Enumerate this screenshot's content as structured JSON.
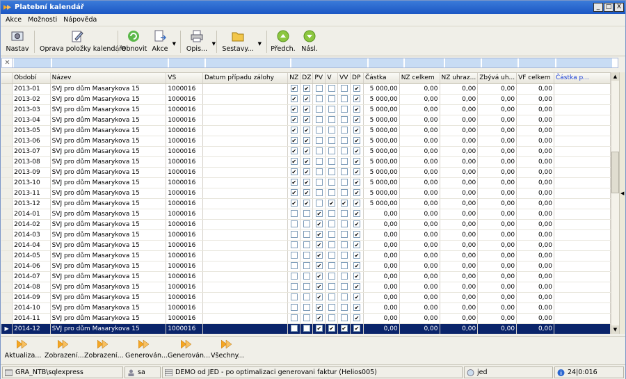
{
  "window": {
    "title": "Platební kalendář",
    "min": "_",
    "max": "□",
    "close": "X"
  },
  "menu": [
    "Akce",
    "Možnosti",
    "Nápověda"
  ],
  "toolbar": {
    "nastav": "Nastav",
    "oprava": "Oprava položky kalendáře",
    "obnovit": "Obnovit",
    "akce": "Akce",
    "opis": "Opis...",
    "sestavy": "Sestavy...",
    "predch": "Předch.",
    "nasl": "Násl."
  },
  "columns": [
    "Období",
    "Název",
    "VS",
    "Datum případu zálohy",
    "NZ",
    "DZ",
    "PV",
    "V",
    "VV",
    "DP",
    "Částka",
    "NZ celkem",
    "NZ uhraz...",
    "Zbývá uh...",
    "VF celkem",
    "Částka p..."
  ],
  "rows": [
    {
      "obdobi": "2013-01",
      "nazev": "SVJ pro dům Masarykova 15",
      "vs": "1000016",
      "datum": "",
      "nz": true,
      "dz": true,
      "pv": false,
      "v": false,
      "vv": false,
      "dp": true,
      "castka": "5 000,00",
      "nzc": "0,00",
      "nzu": "0,00",
      "zbyva": "0,00",
      "vfc": "0,00",
      "castkap": ""
    },
    {
      "obdobi": "2013-02",
      "nazev": "SVJ pro dům Masarykova 15",
      "vs": "1000016",
      "datum": "",
      "nz": true,
      "dz": true,
      "pv": false,
      "v": false,
      "vv": false,
      "dp": true,
      "castka": "5 000,00",
      "nzc": "0,00",
      "nzu": "0,00",
      "zbyva": "0,00",
      "vfc": "0,00",
      "castkap": ""
    },
    {
      "obdobi": "2013-03",
      "nazev": "SVJ pro dům Masarykova 15",
      "vs": "1000016",
      "datum": "",
      "nz": true,
      "dz": true,
      "pv": false,
      "v": false,
      "vv": false,
      "dp": true,
      "castka": "5 000,00",
      "nzc": "0,00",
      "nzu": "0,00",
      "zbyva": "0,00",
      "vfc": "0,00",
      "castkap": ""
    },
    {
      "obdobi": "2013-04",
      "nazev": "SVJ pro dům Masarykova 15",
      "vs": "1000016",
      "datum": "",
      "nz": true,
      "dz": true,
      "pv": false,
      "v": false,
      "vv": false,
      "dp": true,
      "castka": "5 000,00",
      "nzc": "0,00",
      "nzu": "0,00",
      "zbyva": "0,00",
      "vfc": "0,00",
      "castkap": ""
    },
    {
      "obdobi": "2013-05",
      "nazev": "SVJ pro dům Masarykova 15",
      "vs": "1000016",
      "datum": "",
      "nz": true,
      "dz": true,
      "pv": false,
      "v": false,
      "vv": false,
      "dp": true,
      "castka": "5 000,00",
      "nzc": "0,00",
      "nzu": "0,00",
      "zbyva": "0,00",
      "vfc": "0,00",
      "castkap": ""
    },
    {
      "obdobi": "2013-06",
      "nazev": "SVJ pro dům Masarykova 15",
      "vs": "1000016",
      "datum": "",
      "nz": true,
      "dz": true,
      "pv": false,
      "v": false,
      "vv": false,
      "dp": true,
      "castka": "5 000,00",
      "nzc": "0,00",
      "nzu": "0,00",
      "zbyva": "0,00",
      "vfc": "0,00",
      "castkap": ""
    },
    {
      "obdobi": "2013-07",
      "nazev": "SVJ pro dům Masarykova 15",
      "vs": "1000016",
      "datum": "",
      "nz": true,
      "dz": true,
      "pv": false,
      "v": false,
      "vv": false,
      "dp": true,
      "castka": "5 000,00",
      "nzc": "0,00",
      "nzu": "0,00",
      "zbyva": "0,00",
      "vfc": "0,00",
      "castkap": ""
    },
    {
      "obdobi": "2013-08",
      "nazev": "SVJ pro dům Masarykova 15",
      "vs": "1000016",
      "datum": "",
      "nz": true,
      "dz": true,
      "pv": false,
      "v": false,
      "vv": false,
      "dp": true,
      "castka": "5 000,00",
      "nzc": "0,00",
      "nzu": "0,00",
      "zbyva": "0,00",
      "vfc": "0,00",
      "castkap": ""
    },
    {
      "obdobi": "2013-09",
      "nazev": "SVJ pro dům Masarykova 15",
      "vs": "1000016",
      "datum": "",
      "nz": true,
      "dz": true,
      "pv": false,
      "v": false,
      "vv": false,
      "dp": true,
      "castka": "5 000,00",
      "nzc": "0,00",
      "nzu": "0,00",
      "zbyva": "0,00",
      "vfc": "0,00",
      "castkap": ""
    },
    {
      "obdobi": "2013-10",
      "nazev": "SVJ pro dům Masarykova 15",
      "vs": "1000016",
      "datum": "",
      "nz": true,
      "dz": true,
      "pv": false,
      "v": false,
      "vv": false,
      "dp": true,
      "castka": "5 000,00",
      "nzc": "0,00",
      "nzu": "0,00",
      "zbyva": "0,00",
      "vfc": "0,00",
      "castkap": ""
    },
    {
      "obdobi": "2013-11",
      "nazev": "SVJ pro dům Masarykova 15",
      "vs": "1000016",
      "datum": "",
      "nz": true,
      "dz": true,
      "pv": false,
      "v": false,
      "vv": false,
      "dp": true,
      "castka": "5 000,00",
      "nzc": "0,00",
      "nzu": "0,00",
      "zbyva": "0,00",
      "vfc": "0,00",
      "castkap": ""
    },
    {
      "obdobi": "2013-12",
      "nazev": "SVJ pro dům Masarykova 15",
      "vs": "1000016",
      "datum": "",
      "nz": true,
      "dz": true,
      "pv": false,
      "v": true,
      "vv": true,
      "dp": true,
      "castka": "5 000,00",
      "nzc": "0,00",
      "nzu": "0,00",
      "zbyva": "0,00",
      "vfc": "0,00",
      "castkap": ""
    },
    {
      "obdobi": "2014-01",
      "nazev": "SVJ pro dům Masarykova 15",
      "vs": "1000016",
      "datum": "",
      "nz": false,
      "dz": false,
      "pv": true,
      "v": false,
      "vv": false,
      "dp": true,
      "castka": "0,00",
      "nzc": "0,00",
      "nzu": "0,00",
      "zbyva": "0,00",
      "vfc": "0,00",
      "castkap": ""
    },
    {
      "obdobi": "2014-02",
      "nazev": "SVJ pro dům Masarykova 15",
      "vs": "1000016",
      "datum": "",
      "nz": false,
      "dz": false,
      "pv": true,
      "v": false,
      "vv": false,
      "dp": true,
      "castka": "0,00",
      "nzc": "0,00",
      "nzu": "0,00",
      "zbyva": "0,00",
      "vfc": "0,00",
      "castkap": ""
    },
    {
      "obdobi": "2014-03",
      "nazev": "SVJ pro dům Masarykova 15",
      "vs": "1000016",
      "datum": "",
      "nz": false,
      "dz": false,
      "pv": true,
      "v": false,
      "vv": false,
      "dp": true,
      "castka": "0,00",
      "nzc": "0,00",
      "nzu": "0,00",
      "zbyva": "0,00",
      "vfc": "0,00",
      "castkap": ""
    },
    {
      "obdobi": "2014-04",
      "nazev": "SVJ pro dům Masarykova 15",
      "vs": "1000016",
      "datum": "",
      "nz": false,
      "dz": false,
      "pv": true,
      "v": false,
      "vv": false,
      "dp": true,
      "castka": "0,00",
      "nzc": "0,00",
      "nzu": "0,00",
      "zbyva": "0,00",
      "vfc": "0,00",
      "castkap": ""
    },
    {
      "obdobi": "2014-05",
      "nazev": "SVJ pro dům Masarykova 15",
      "vs": "1000016",
      "datum": "",
      "nz": false,
      "dz": false,
      "pv": true,
      "v": false,
      "vv": false,
      "dp": true,
      "castka": "0,00",
      "nzc": "0,00",
      "nzu": "0,00",
      "zbyva": "0,00",
      "vfc": "0,00",
      "castkap": ""
    },
    {
      "obdobi": "2014-06",
      "nazev": "SVJ pro dům Masarykova 15",
      "vs": "1000016",
      "datum": "",
      "nz": false,
      "dz": false,
      "pv": true,
      "v": false,
      "vv": false,
      "dp": true,
      "castka": "0,00",
      "nzc": "0,00",
      "nzu": "0,00",
      "zbyva": "0,00",
      "vfc": "0,00",
      "castkap": ""
    },
    {
      "obdobi": "2014-07",
      "nazev": "SVJ pro dům Masarykova 15",
      "vs": "1000016",
      "datum": "",
      "nz": false,
      "dz": false,
      "pv": true,
      "v": false,
      "vv": false,
      "dp": true,
      "castka": "0,00",
      "nzc": "0,00",
      "nzu": "0,00",
      "zbyva": "0,00",
      "vfc": "0,00",
      "castkap": ""
    },
    {
      "obdobi": "2014-08",
      "nazev": "SVJ pro dům Masarykova 15",
      "vs": "1000016",
      "datum": "",
      "nz": false,
      "dz": false,
      "pv": true,
      "v": false,
      "vv": false,
      "dp": true,
      "castka": "0,00",
      "nzc": "0,00",
      "nzu": "0,00",
      "zbyva": "0,00",
      "vfc": "0,00",
      "castkap": ""
    },
    {
      "obdobi": "2014-09",
      "nazev": "SVJ pro dům Masarykova 15",
      "vs": "1000016",
      "datum": "",
      "nz": false,
      "dz": false,
      "pv": true,
      "v": false,
      "vv": false,
      "dp": true,
      "castka": "0,00",
      "nzc": "0,00",
      "nzu": "0,00",
      "zbyva": "0,00",
      "vfc": "0,00",
      "castkap": ""
    },
    {
      "obdobi": "2014-10",
      "nazev": "SVJ pro dům Masarykova 15",
      "vs": "1000016",
      "datum": "",
      "nz": false,
      "dz": false,
      "pv": true,
      "v": false,
      "vv": false,
      "dp": true,
      "castka": "0,00",
      "nzc": "0,00",
      "nzu": "0,00",
      "zbyva": "0,00",
      "vfc": "0,00",
      "castkap": ""
    },
    {
      "obdobi": "2014-11",
      "nazev": "SVJ pro dům Masarykova 15",
      "vs": "1000016",
      "datum": "",
      "nz": false,
      "dz": false,
      "pv": true,
      "v": false,
      "vv": false,
      "dp": true,
      "castka": "0,00",
      "nzc": "0,00",
      "nzu": "0,00",
      "zbyva": "0,00",
      "vfc": "0,00",
      "castkap": ""
    },
    {
      "obdobi": "2014-12",
      "nazev": "SVJ pro dům Masarykova 15",
      "vs": "1000016",
      "datum": "",
      "nz": false,
      "dz": false,
      "pv": true,
      "v": true,
      "vv": true,
      "dp": true,
      "castka": "0,00",
      "nzc": "0,00",
      "nzu": "0,00",
      "zbyva": "0,00",
      "vfc": "0,00",
      "castkap": "",
      "selected": true
    }
  ],
  "bottom": [
    "Aktualiza...",
    "Zobrazení...",
    "Zobrazení...",
    "Generován...",
    "Generován...",
    "Všechny..."
  ],
  "status": {
    "server": "GRA_NTB\\sqlexpress",
    "user": "sa",
    "db": "DEMO od JED - po optimalizaci generovani faktur (Helios005)",
    "lang": "jed",
    "info": "24|0:016"
  },
  "colors": {
    "title": "#2a66d0",
    "selection": "#0a246a",
    "filter": "#c8dcf4"
  }
}
